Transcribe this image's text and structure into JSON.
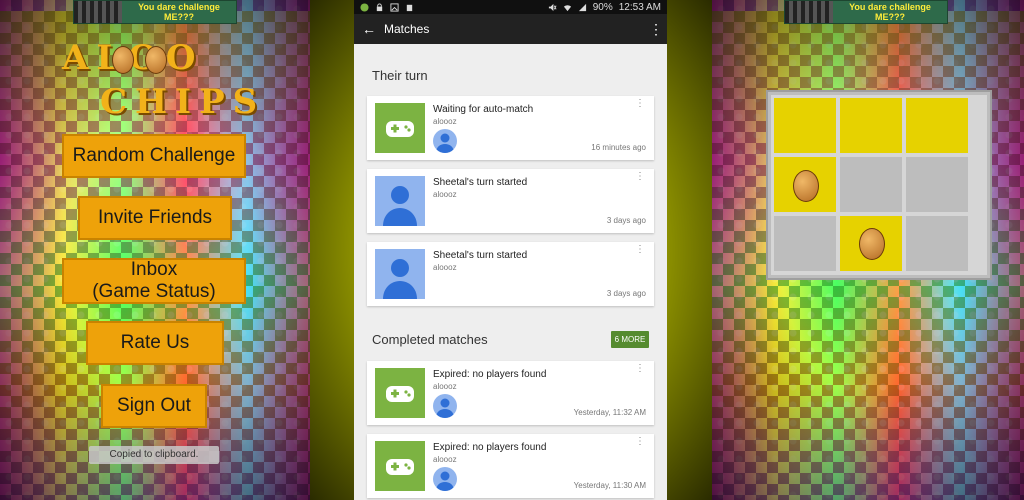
{
  "left_menu": {
    "banner_text": "You dare challenge ME???",
    "logo_line1": "ALOO",
    "logo_line2": "CHIPS",
    "buttons": [
      {
        "label": "Random Challenge"
      },
      {
        "label": "Invite Friends"
      },
      {
        "label": "Inbox\n(Game Status)"
      },
      {
        "label": "Rate Us"
      },
      {
        "label": "Sign Out"
      }
    ],
    "toast": "Copied to clipboard."
  },
  "phone": {
    "status": {
      "battery": "90%",
      "time": "12:53 AM"
    },
    "toolbar_title": "Matches",
    "sections": {
      "their_turn": "Their turn",
      "completed": "Completed matches",
      "more_badge": "6 MORE"
    },
    "their_turn_cards": [
      {
        "title": "Waiting for auto-match",
        "sub": "aloooz",
        "time": "16 minutes ago",
        "art": "game"
      },
      {
        "title": "Sheetal's turn started",
        "sub": "aloooz",
        "time": "3 days ago",
        "art": "person"
      },
      {
        "title": "Sheetal's turn started",
        "sub": "aloooz",
        "time": "3 days ago",
        "art": "person"
      }
    ],
    "completed_cards": [
      {
        "title": "Expired: no players found",
        "sub": "aloooz",
        "time": "Yesterday, 11:32 AM",
        "art": "game"
      },
      {
        "title": "Expired: no players found",
        "sub": "aloooz",
        "time": "Yesterday, 11:30 AM",
        "art": "game"
      }
    ]
  },
  "right_board": {
    "banner_text": "You dare challenge ME???"
  },
  "colors": {
    "button_orange": "#eea20a",
    "game_green": "#7cb342",
    "person_blue": "#90b4ee",
    "badge_green": "#558b2f"
  }
}
